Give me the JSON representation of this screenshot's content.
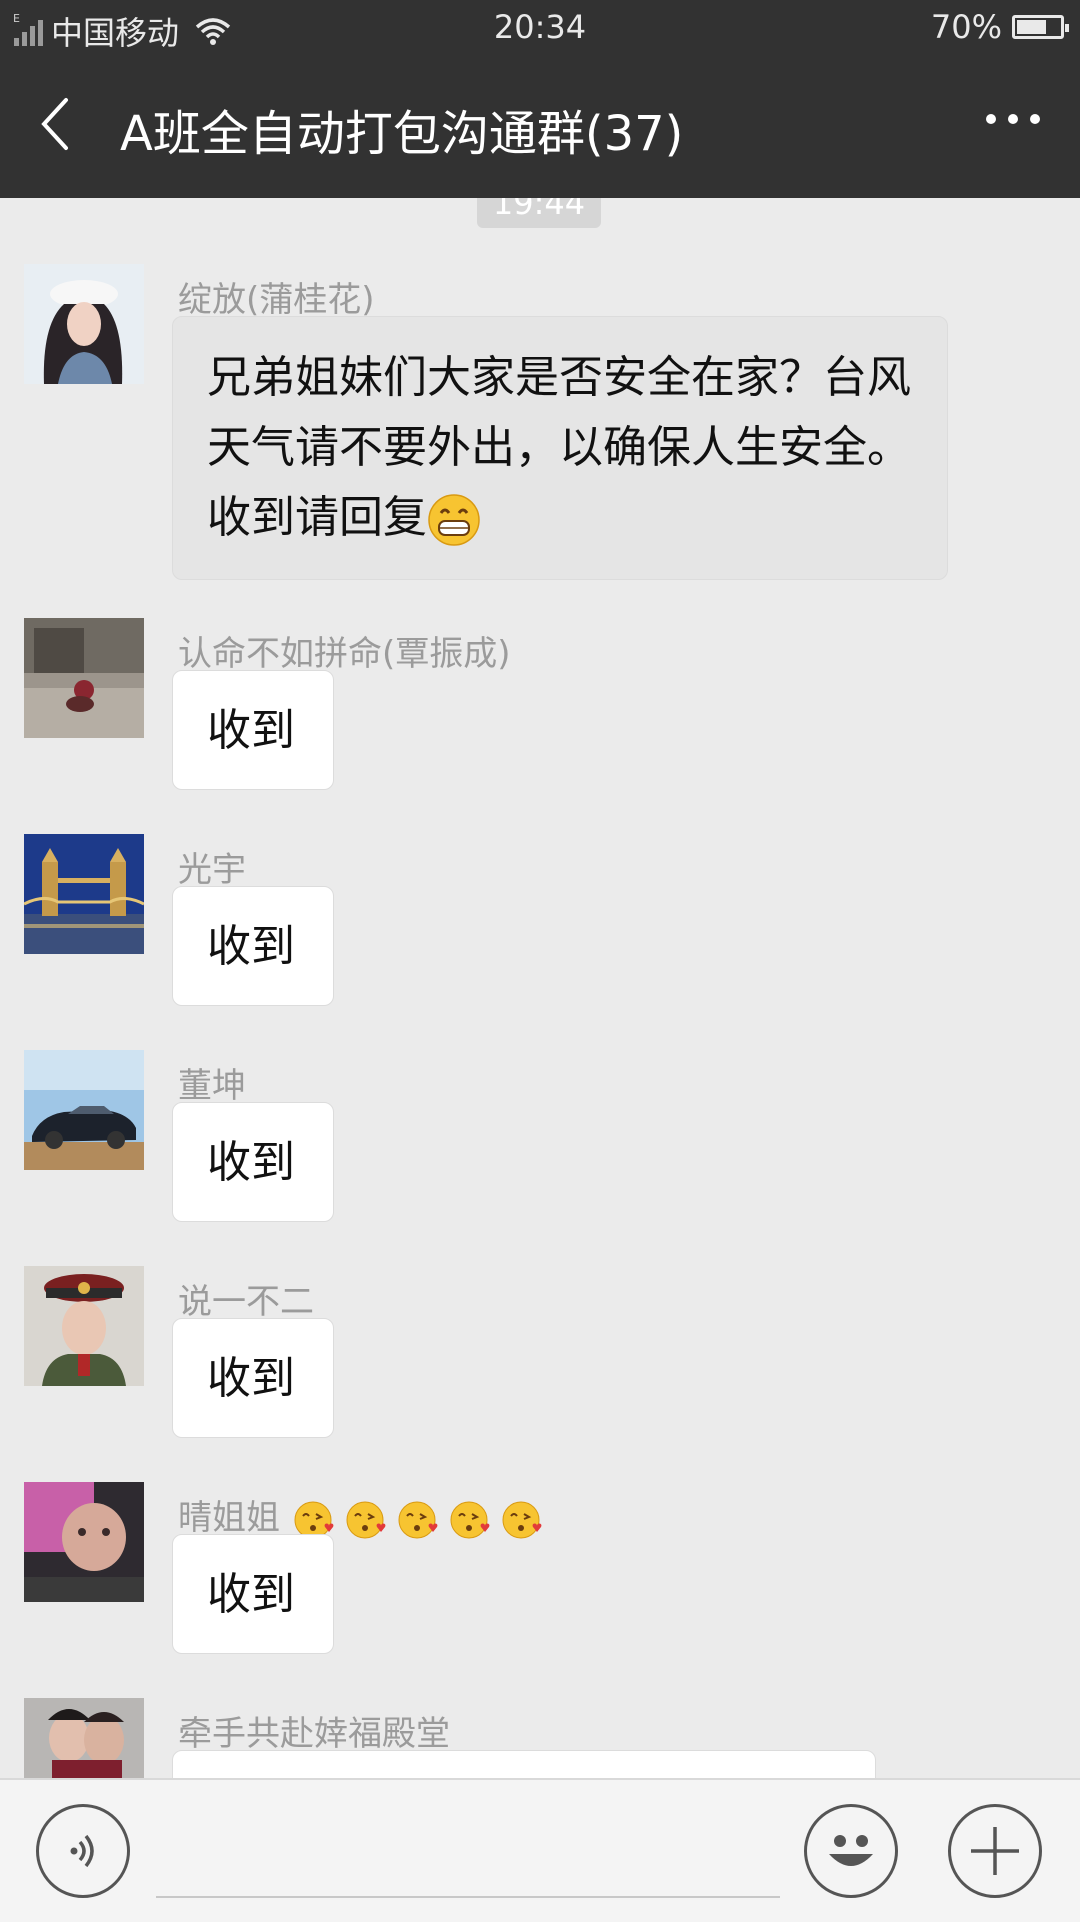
{
  "status_bar": {
    "network_tag": "E",
    "carrier": "中国移动",
    "time": "20:34",
    "battery_percent_label": "70%",
    "battery_level": 0.7
  },
  "header": {
    "title": "A班全自动打包沟通群(37)",
    "back_icon": "chevron-left-icon",
    "more_icon": "more-dots-icon"
  },
  "chat": {
    "time_chip": "19:44",
    "messages": [
      {
        "sender": "绽放(蒲桂花)",
        "text": "兄弟姐妹们大家是否安全在家？台风天气请不要外出，以确保人生安全。收到请回复",
        "emoji": "grin-emoji"
      },
      {
        "sender": "认命不如拼命(覃振成)",
        "text": "收到"
      },
      {
        "sender": "光宇",
        "text": "收到"
      },
      {
        "sender": "董坤",
        "text": "收到"
      },
      {
        "sender": "说一不二",
        "text": "收到"
      },
      {
        "sender": "晴姐姐",
        "sender_emoji": "kissing-heart-emoji ×5",
        "text": "收到"
      },
      {
        "sender": "牵手共赴婞福殿堂",
        "text": ""
      }
    ]
  },
  "input_bar": {
    "voice_icon": "voice-icon",
    "emoji_icon": "smiley-icon",
    "add_icon": "plus-icon"
  },
  "colors": {
    "header_bg": "#323232",
    "chat_bg": "#ebebeb",
    "bubble_bg": "#ffffff",
    "sender_text": "#9b9b9b"
  }
}
